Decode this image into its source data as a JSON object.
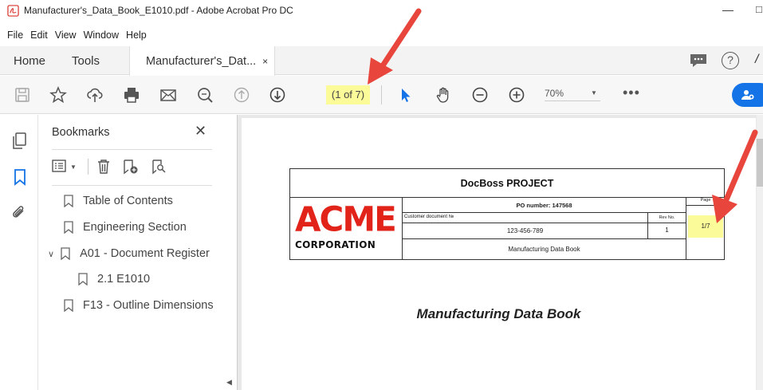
{
  "window": {
    "title": "Manufacturer's_Data_Book_E1010.pdf - Adobe Acrobat Pro DC",
    "minimize_label": "—",
    "maximize_label": "□"
  },
  "menu": {
    "items": [
      "File",
      "Edit",
      "View",
      "Window",
      "Help"
    ]
  },
  "tabs": {
    "home": "Home",
    "tools": "Tools",
    "document": "Manufacturer's_Dat...",
    "close": "×"
  },
  "toolbar": {
    "page_indicator": "(1 of 7)",
    "zoom": "70%",
    "more": "•••"
  },
  "bookmarks_panel": {
    "title": "Bookmarks",
    "close": "✕",
    "items": [
      {
        "label": "Table of Contents"
      },
      {
        "label": "Engineering Section"
      },
      {
        "label": "A01 - Document Register",
        "expanded": true
      },
      {
        "label": "2.1 E1010"
      },
      {
        "label": "F13 - Outline Dimensions"
      }
    ]
  },
  "document": {
    "project": "DocBoss PROJECT",
    "po_number": "PO number: 147568",
    "customer_doc_label": "Customer document №",
    "rev_label": "Rev No.",
    "page_label": "Page",
    "doc_number": "123-456-789",
    "rev_value": "1",
    "page_value": "1/7",
    "book_title_small": "Manufacturing Data Book",
    "logo_text": "ACME",
    "logo_sub": "CORPORATION",
    "main_title": "Manufacturing Data Book"
  },
  "colors": {
    "highlight": "#fbfb9a",
    "accent": "#1473e6",
    "arrow": "#e8453c",
    "logo_red": "#e2231a"
  }
}
